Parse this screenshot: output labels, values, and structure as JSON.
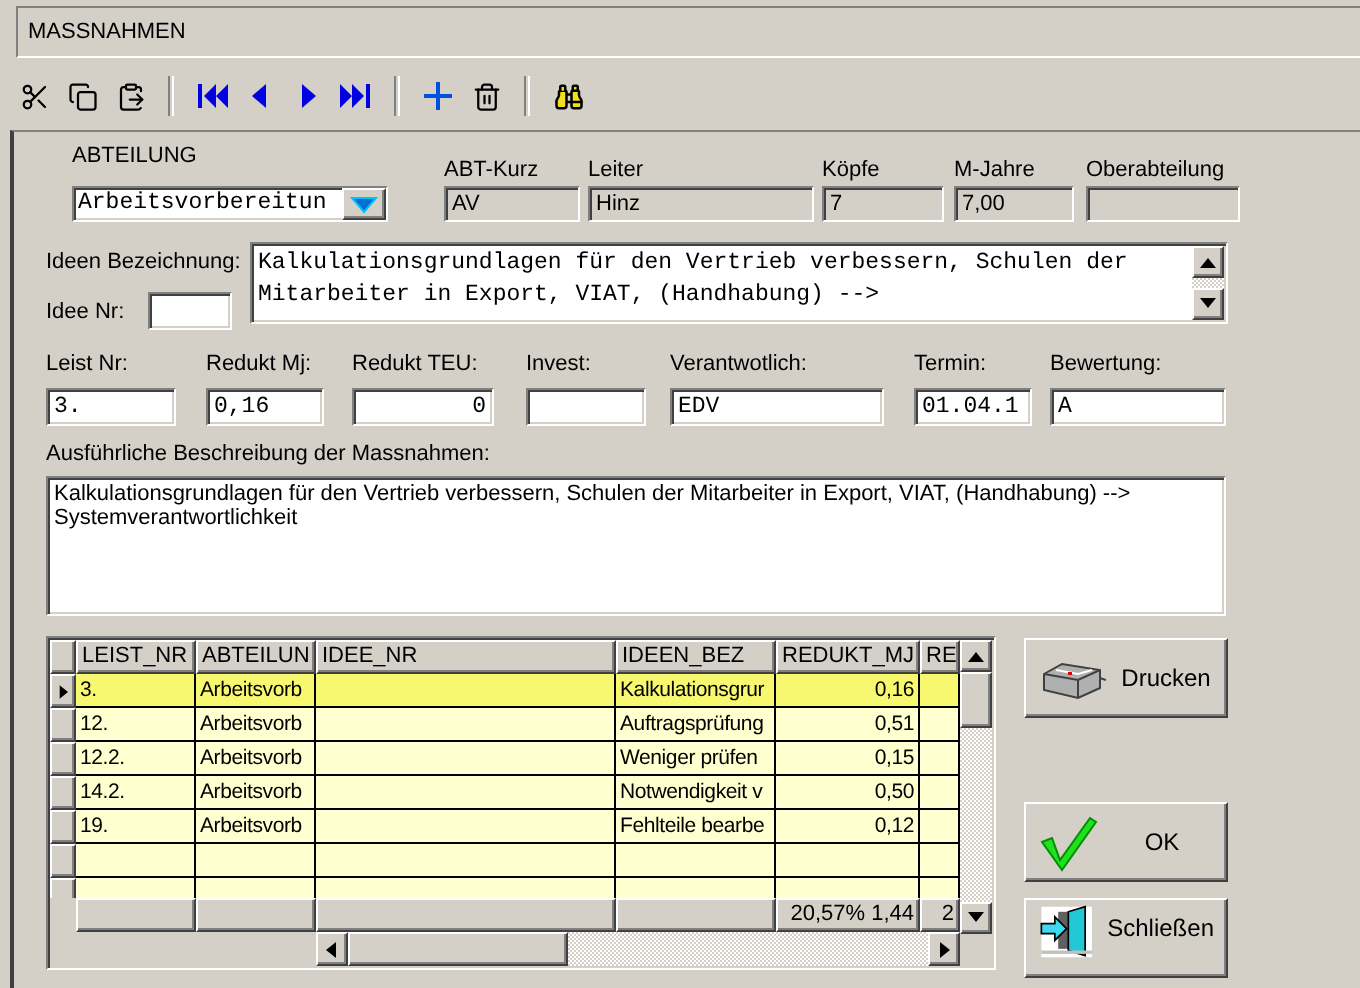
{
  "form": {
    "title": "MASSNAHMEN"
  },
  "header_fields": [
    {
      "label": "ABTEILUNG",
      "value": "Arbeitsvorbereitun",
      "kind": "dropdown"
    },
    {
      "label": "ABT-Kurz",
      "value": "AV",
      "kind": "readonly"
    },
    {
      "label": "Leiter",
      "value": "Hinz",
      "kind": "readonly"
    },
    {
      "label": "Köpfe",
      "value": "7",
      "kind": "readonly"
    },
    {
      "label": "M-Jahre",
      "value": "7,00",
      "kind": "readonly"
    },
    {
      "label": "Oberabteilung",
      "kind": "readonly"
    }
  ],
  "idea": {
    "label": "Ideen Bezeichnung:",
    "number_label": "Idee Nr:",
    "text": "Kalkulationsgrundlagen für den Vertrieb verbessern, Schulen der Mitarbeiter in Export, VIAT, (Handhabung) -->"
  },
  "detail_fields": [
    {
      "label": "Leist Nr:",
      "value": "3.",
      "kind": "text"
    },
    {
      "label": "Redukt Mj:",
      "value": "0,16",
      "kind": "text"
    },
    {
      "label": "Redukt TEU:",
      "value": "0",
      "kind": "number"
    },
    {
      "label": "Invest:",
      "kind": "text"
    },
    {
      "label": "Verantwotlich:",
      "value": "EDV",
      "kind": "text"
    },
    {
      "label": "Termin:",
      "value": "01.04.1",
      "kind": "text"
    },
    {
      "label": "Bewertung:",
      "value": "A",
      "kind": "text"
    }
  ],
  "description": {
    "label": "Ausführliche Beschreibung der Massnahmen:",
    "text": "Kalkulationsgrundlagen für den Vertrieb verbessern, Schulen der Mitarbeiter in Export, VIAT, (Handhabung) -->\nSystemverantwortlichkeit"
  },
  "table": {
    "columns": [
      "LEIST_NR",
      "ABTEILUN",
      "IDEE_NR",
      "IDEEN_BEZ",
      "REDUKT_MJ",
      "RE"
    ],
    "rows": [
      {
        "selected": true,
        "cells": [
          "3.",
          "Arbeitsvorb",
          "",
          "Kalkulationsgrur",
          "0,16",
          ""
        ]
      },
      {
        "selected": false,
        "cells": [
          "12.",
          "Arbeitsvorb",
          "",
          "Auftragsprüfung",
          "0,51",
          ""
        ]
      },
      {
        "selected": false,
        "cells": [
          "12.2.",
          "Arbeitsvorb",
          "",
          "Weniger prüfen",
          "0,15",
          ""
        ]
      },
      {
        "selected": false,
        "cells": [
          "14.2.",
          "Arbeitsvorb",
          "",
          "Notwendigkeit v",
          "0,50",
          ""
        ]
      },
      {
        "selected": false,
        "cells": [
          "19.",
          "Arbeitsvorb",
          "",
          "Fehlteile bearbe",
          "0,12",
          ""
        ]
      }
    ],
    "footer": {
      "redukt_mj": "20,57%  1,44",
      "column_6": "2"
    }
  },
  "buttons": [
    {
      "label": "Drucken",
      "kind": "print"
    },
    {
      "label": "OK",
      "kind": "ok"
    },
    {
      "label": "Schließen",
      "kind": "close"
    }
  ]
}
